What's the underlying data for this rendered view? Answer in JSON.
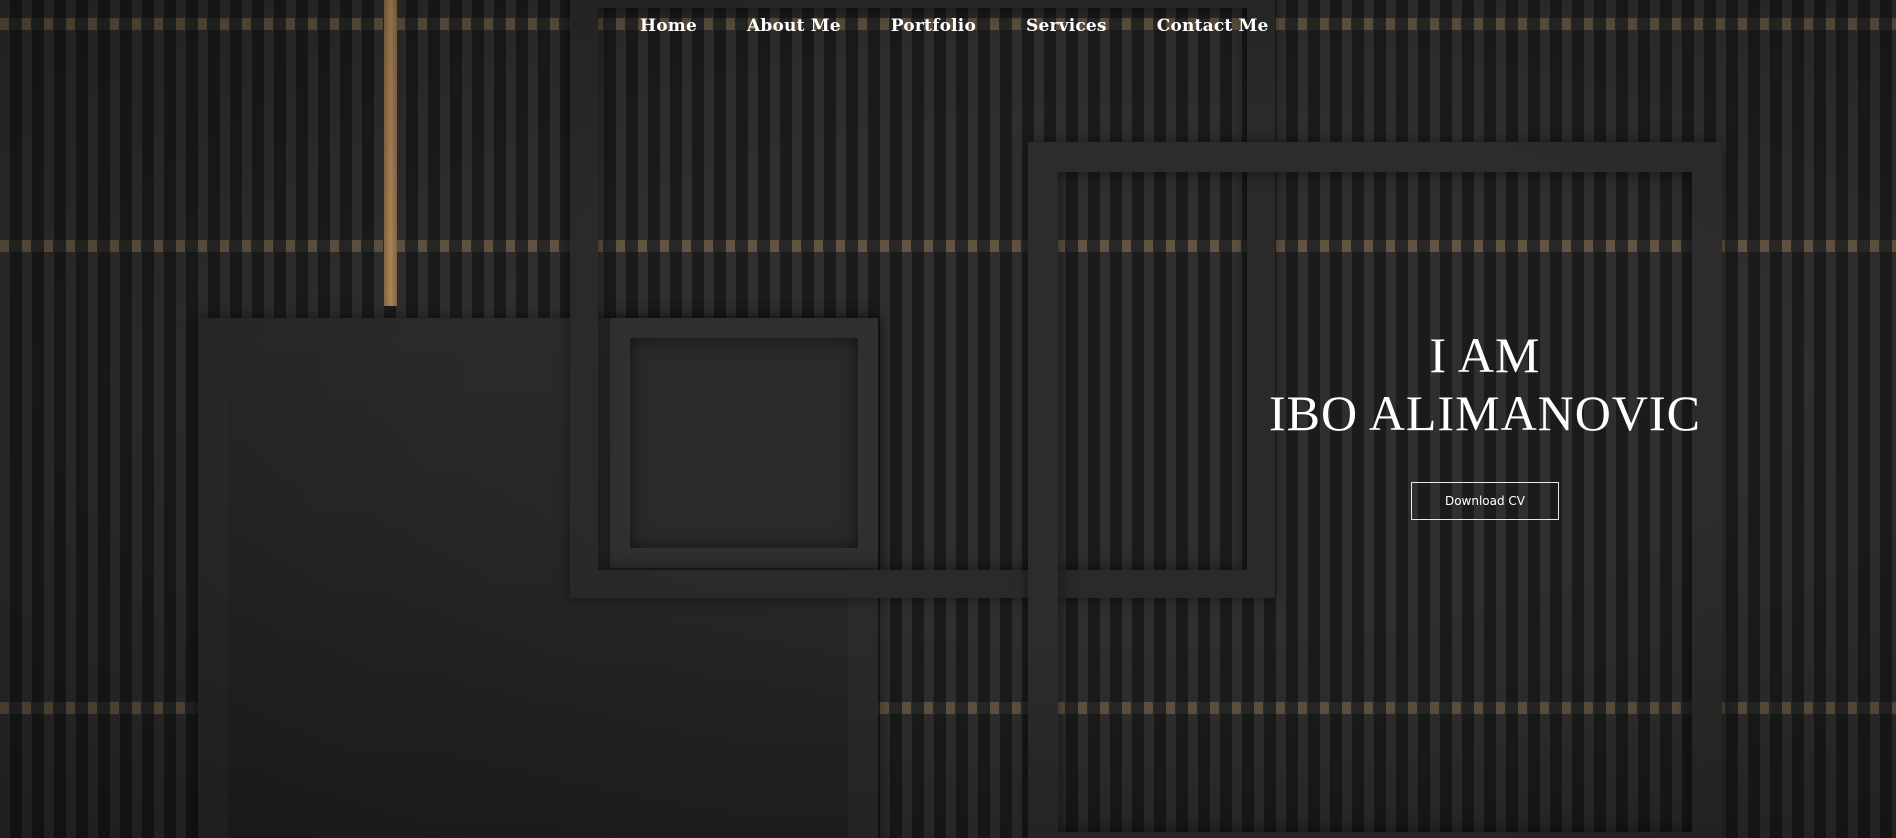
{
  "nav": {
    "items": [
      {
        "label": "Home"
      },
      {
        "label": "About Me"
      },
      {
        "label": "Portfolio"
      },
      {
        "label": "Services"
      },
      {
        "label": "Contact Me"
      }
    ]
  },
  "hero": {
    "line1": "I AM",
    "line2": "IBO ALIMANOVIC",
    "cv_button": "Download CV"
  },
  "colors": {
    "accent_bronze": "#b48a5c",
    "background": "#222222",
    "text": "#ffffff"
  }
}
